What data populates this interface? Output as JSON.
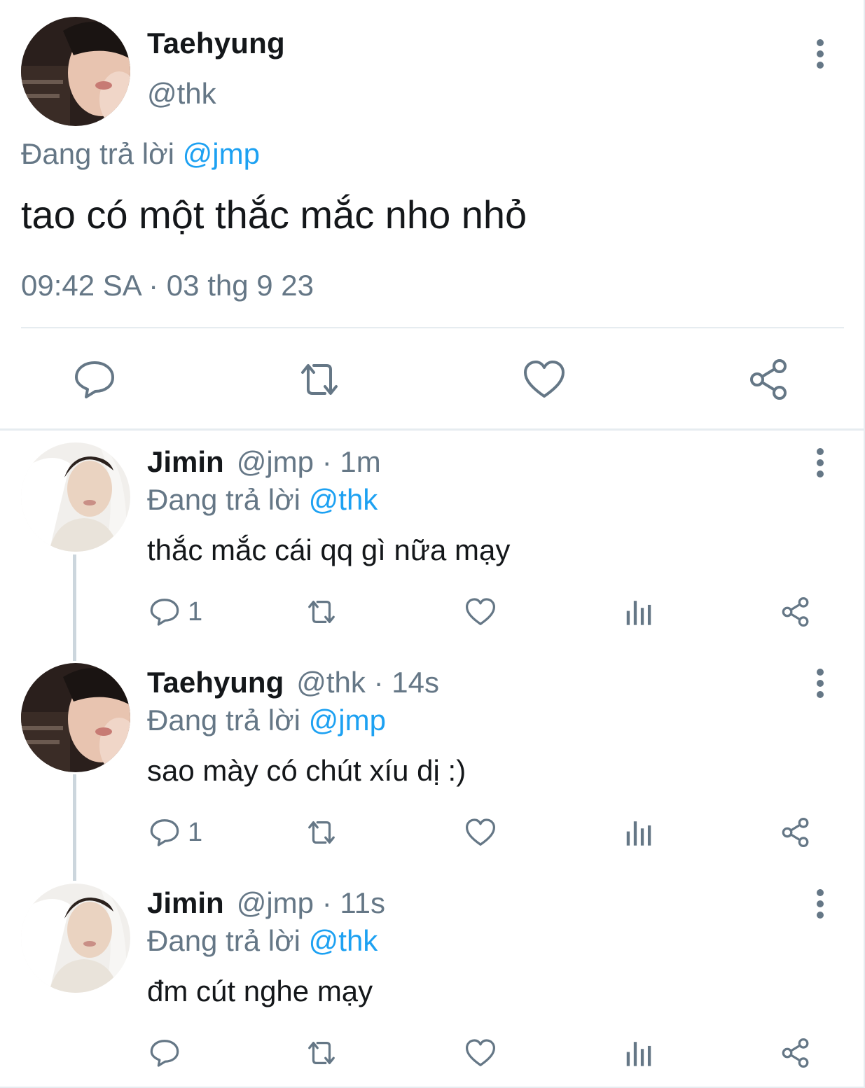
{
  "main_tweet": {
    "name": "Taehyung",
    "handle": "@thk",
    "reply_prefix": "Đang trả lời",
    "reply_to": "@jmp",
    "text": "tao có một thắc mắc nho nhỏ",
    "timestamp": "09:42 SA · 03 thg 9 23",
    "actions": [
      "reply-icon",
      "retweet-icon",
      "like-icon",
      "share-icon"
    ]
  },
  "replies": [
    {
      "name": "Jimin",
      "handle": "@jmp",
      "time": "· 1m",
      "reply_prefix": "Đang trả lời",
      "reply_to": "@thk",
      "text": "thắc mắc cái qq gì nữa mạy",
      "reply_count": "1"
    },
    {
      "name": "Taehyung",
      "handle": "@thk",
      "time": "· 14s",
      "reply_prefix": "Đang trả lời",
      "reply_to": "@jmp",
      "text": "sao mày có chút xíu dị :)",
      "reply_count": "1"
    },
    {
      "name": "Jimin",
      "handle": "@jmp",
      "time": "· 11s",
      "reply_prefix": "Đang trả lời",
      "reply_to": "@thk",
      "text": "đm cút nghe mạy",
      "reply_count": ""
    }
  ],
  "colors": {
    "text": "#14171a",
    "muted": "#657786",
    "link": "#1da1f2",
    "divider": "#e6ecf0"
  }
}
